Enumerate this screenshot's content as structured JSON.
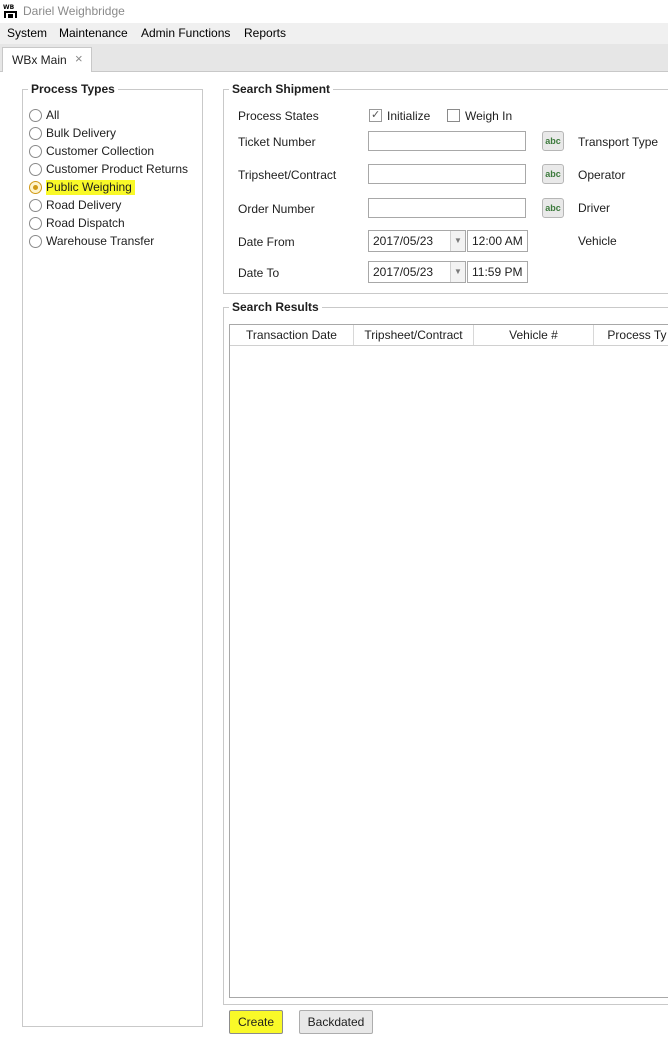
{
  "window": {
    "title": "Dariel Weighbridge",
    "icon": "wbx-app-icon"
  },
  "menu": [
    "System",
    "Maintenance",
    "Admin Functions",
    "Reports"
  ],
  "tabs": [
    {
      "label": "WBx Main",
      "close": "×"
    }
  ],
  "process_types": {
    "title": "Process Types",
    "options": [
      {
        "label": "All",
        "checked": false
      },
      {
        "label": "Bulk Delivery",
        "checked": false
      },
      {
        "label": "Customer Collection",
        "checked": false
      },
      {
        "label": "Customer Product Returns",
        "checked": false
      },
      {
        "label": "Public Weighing",
        "checked": true
      },
      {
        "label": "Road Delivery",
        "checked": false
      },
      {
        "label": "Road Dispatch",
        "checked": false
      },
      {
        "label": "Warehouse Transfer",
        "checked": false
      }
    ],
    "highlight_color": "#f9f928"
  },
  "search_shipment": {
    "title": "Search Shipment",
    "process_states_label": "Process States",
    "initialize_label": "Initialize",
    "initialize_checked": true,
    "weigh_in_label": "Weigh In",
    "weigh_in_checked": false,
    "ticket_number_label": "Ticket Number",
    "ticket_number_value": "",
    "tripsheet_label": "Tripsheet/Contract",
    "tripsheet_value": "",
    "order_number_label": "Order Number",
    "order_number_value": "",
    "abc_button_label": "abc",
    "date_from_label": "Date From",
    "date_from_value": "2017/05/23",
    "time_from_value": "12:00 AM",
    "date_to_label": "Date To",
    "date_to_value": "2017/05/23",
    "time_to_value": "11:59 PM",
    "transport_type_label": "Transport Type",
    "operator_label": "Operator",
    "driver_label": "Driver",
    "vehicle_label": "Vehicle"
  },
  "search_results": {
    "title": "Search Results",
    "columns": [
      "Transaction Date",
      "Tripsheet/Contract",
      "Vehicle #",
      "Process Ty"
    ]
  },
  "buttons": {
    "create_label": "Create",
    "backdated_label": "Backdated"
  }
}
